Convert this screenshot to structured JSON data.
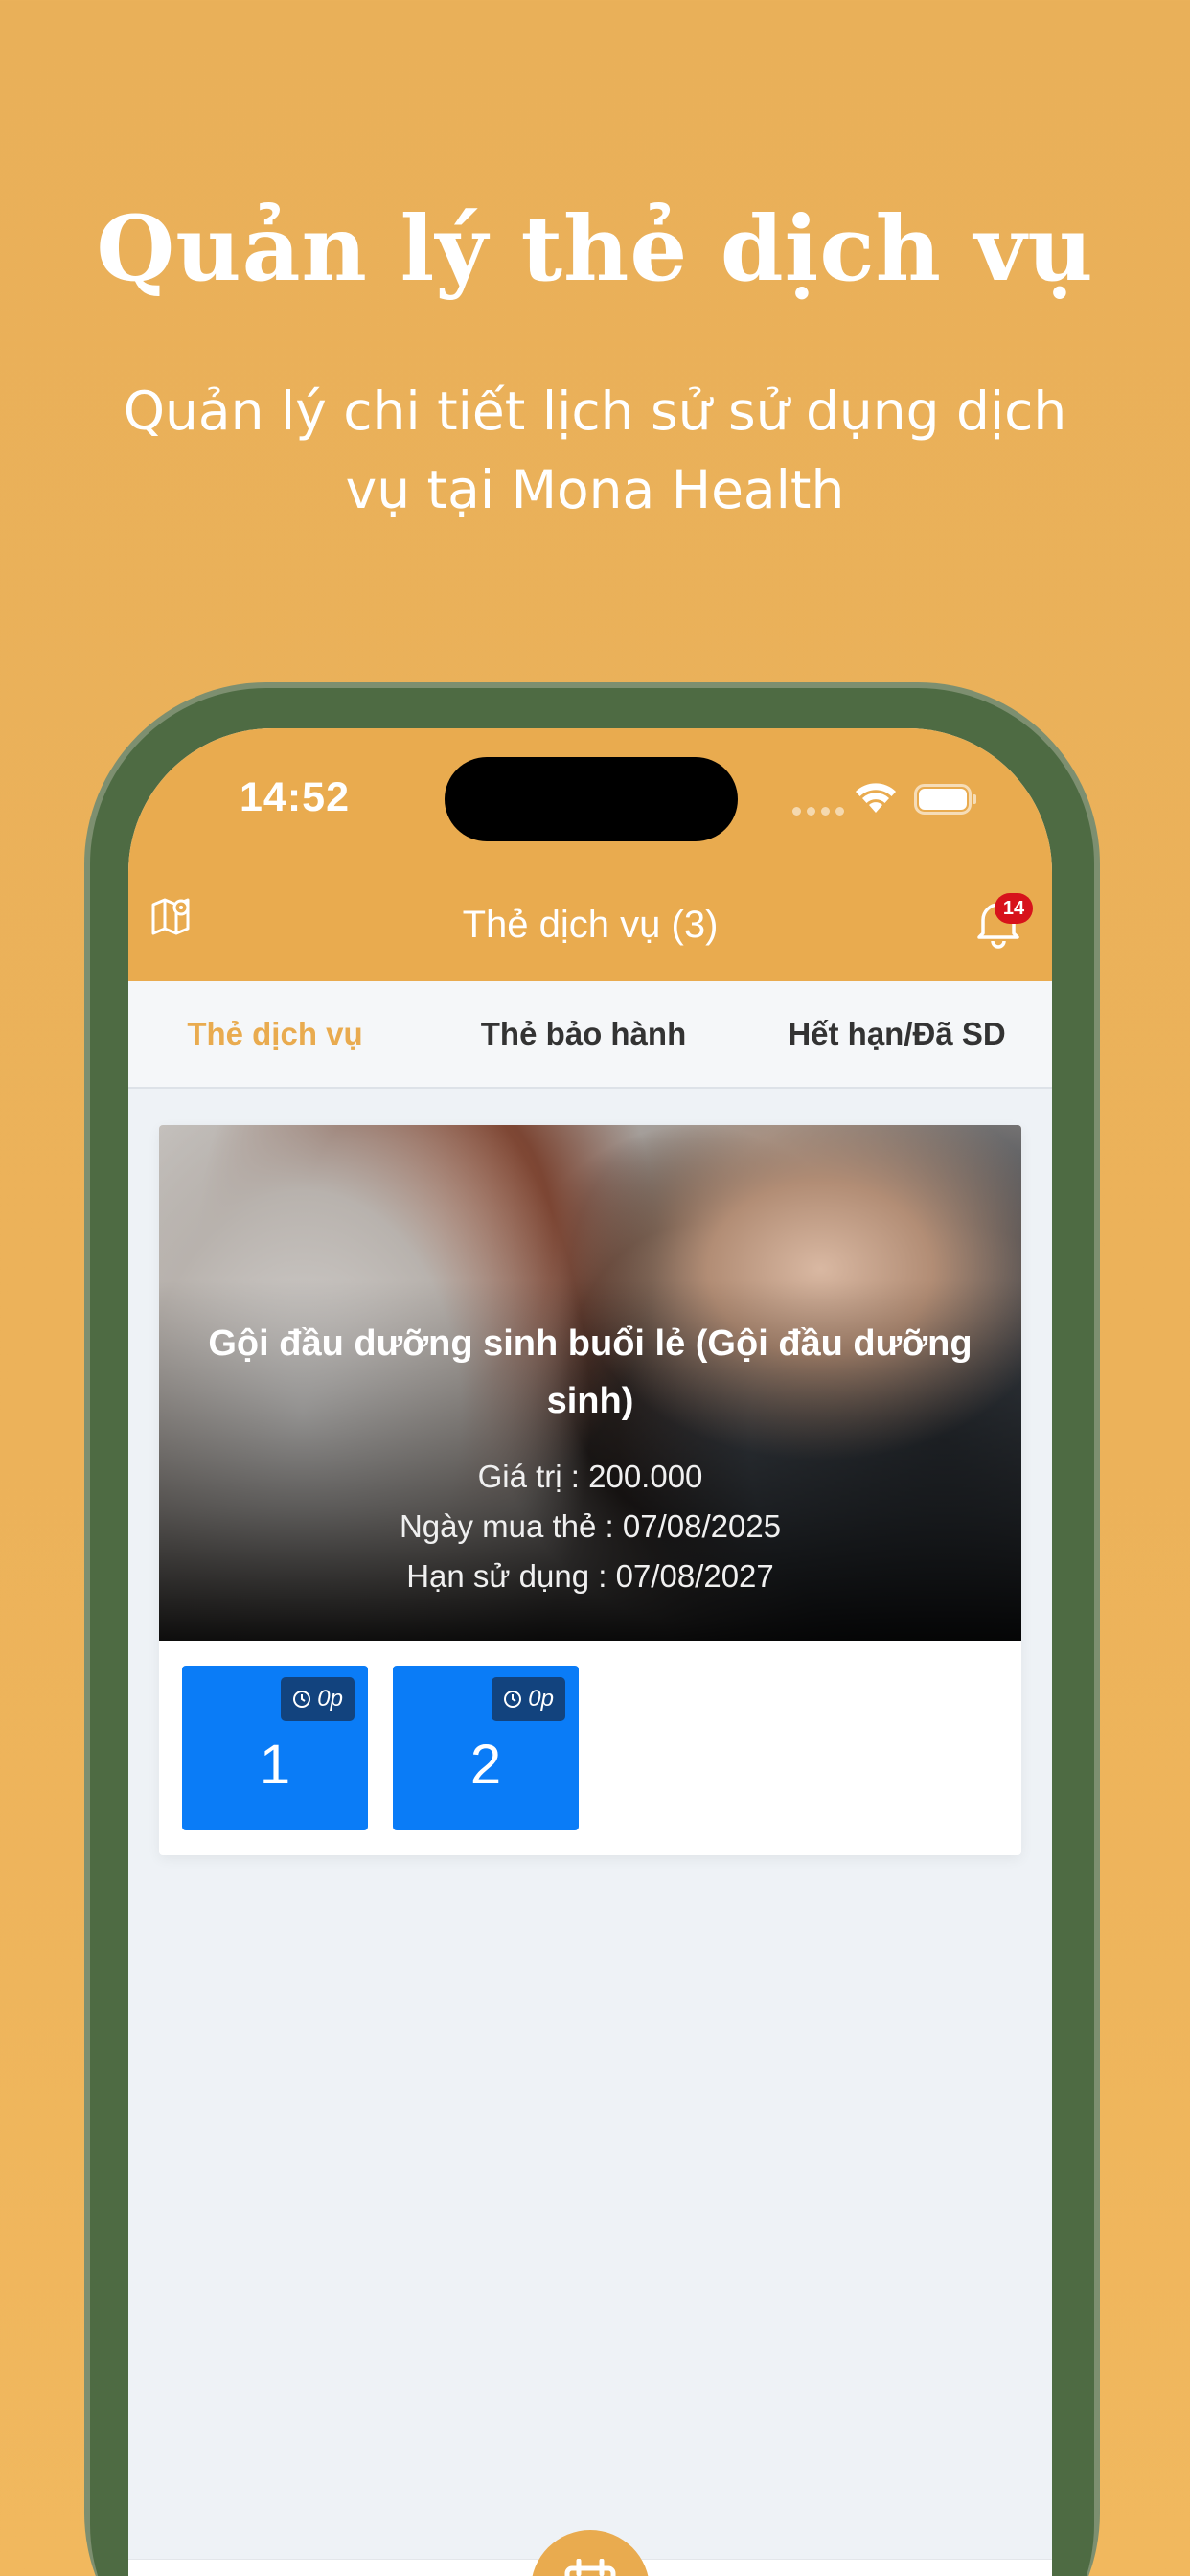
{
  "promo": {
    "title": "Quản lý thẻ dịch vụ",
    "subtitle": "Quản lý chi tiết lịch sử sử dụng dịch vụ tại Mona Health"
  },
  "status_bar": {
    "time": "14:52"
  },
  "header": {
    "title": "Thẻ dịch vụ (3)",
    "notification_count": "14",
    "left_icon": "map-pin-icon",
    "right_icon": "bell-icon"
  },
  "tabs": [
    {
      "label": "Thẻ dịch vụ",
      "active": true
    },
    {
      "label": "Thẻ bảo hành",
      "active": false
    },
    {
      "label": "Hết hạn/Đã SD",
      "active": false
    }
  ],
  "card": {
    "title": "Gội đầu dưỡng sinh buổi lẻ (Gội đầu dưỡng sinh)",
    "value_line": "Giá trị : 200.000",
    "purchase_date_line": "Ngày mua thẻ : 07/08/2025",
    "expiry_line": "Hạn sử dụng : 07/08/2027",
    "sessions": [
      {
        "number": "1",
        "duration": "0p"
      },
      {
        "number": "2",
        "duration": "0p"
      }
    ]
  },
  "colors": {
    "brand": "#e9ab4f",
    "session_blue": "#0a7cf7",
    "badge_navy": "#12437e",
    "notification_red": "#d7121b"
  }
}
